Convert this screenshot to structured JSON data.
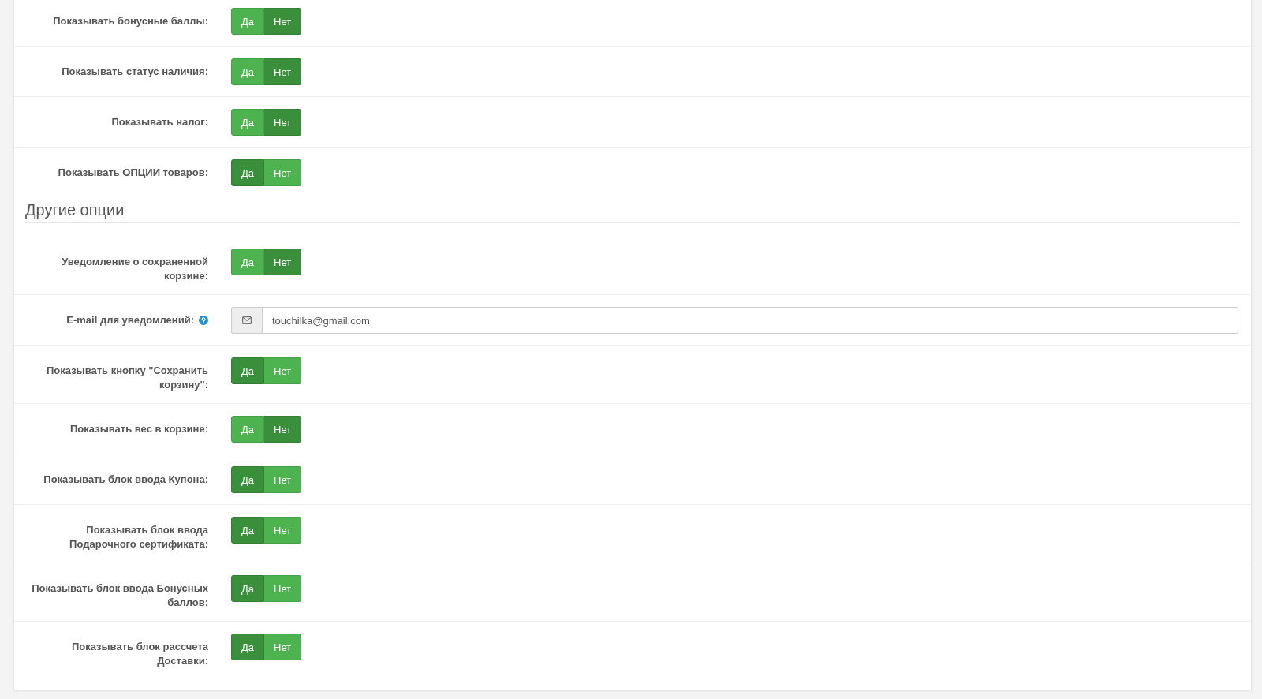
{
  "sections": [
    {
      "rows": [
        {
          "kind": "toggle",
          "label": "Показывать бонусные баллы:",
          "options": [
            {
              "label": "Да",
              "selected": false
            },
            {
              "label": "Нет",
              "selected": true
            }
          ]
        },
        {
          "kind": "toggle",
          "label": "Показывать статус наличия:",
          "options": [
            {
              "label": "Да",
              "selected": false
            },
            {
              "label": "Нет",
              "selected": true
            }
          ]
        },
        {
          "kind": "toggle",
          "label": "Показывать налог:",
          "options": [
            {
              "label": "Да",
              "selected": false
            },
            {
              "label": "Нет",
              "selected": true
            }
          ]
        },
        {
          "kind": "toggle",
          "label": "Показывать ОПЦИИ товаров:",
          "options": [
            {
              "label": "Да",
              "selected": true
            },
            {
              "label": "Нет",
              "selected": false
            }
          ]
        }
      ]
    },
    {
      "title": "Другие опции",
      "rows": [
        {
          "kind": "toggle",
          "label": "Уведомление о сохраненной корзине:",
          "options": [
            {
              "label": "Да",
              "selected": false
            },
            {
              "label": "Нет",
              "selected": true
            }
          ]
        },
        {
          "kind": "email",
          "label": "E-mail для уведомлений:",
          "value": "touchilka@gmail.com"
        },
        {
          "kind": "toggle",
          "label": "Показывать кнопку \"Сохранить корзину\":",
          "options": [
            {
              "label": "Да",
              "selected": true
            },
            {
              "label": "Нет",
              "selected": false
            }
          ]
        },
        {
          "kind": "toggle",
          "label": "Показывать вес в корзине:",
          "options": [
            {
              "label": "Да",
              "selected": false
            },
            {
              "label": "Нет",
              "selected": true
            }
          ]
        },
        {
          "kind": "toggle",
          "label": "Показывать блок ввода Купона:",
          "options": [
            {
              "label": "Да",
              "selected": true
            },
            {
              "label": "Нет",
              "selected": false
            }
          ]
        },
        {
          "kind": "toggle",
          "label": "Показывать блок ввода Подарочного сертификата:",
          "options": [
            {
              "label": "Да",
              "selected": true
            },
            {
              "label": "Нет",
              "selected": false
            }
          ]
        },
        {
          "kind": "toggle",
          "label": "Показывать блок ввода Бонусных баллов:",
          "options": [
            {
              "label": "Да",
              "selected": true
            },
            {
              "label": "Нет",
              "selected": false
            }
          ]
        },
        {
          "kind": "toggle",
          "label": "Показывать блок рассчета Доставки:",
          "options": [
            {
              "label": "Да",
              "selected": true
            },
            {
              "label": "Нет",
              "selected": false
            }
          ]
        }
      ]
    }
  ]
}
